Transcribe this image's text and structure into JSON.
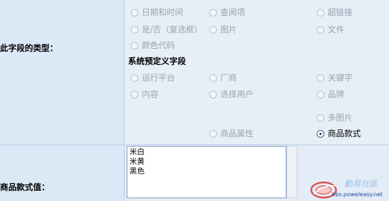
{
  "fields": {
    "type_label": "此字段的类型：",
    "value_label": "商品款式值："
  },
  "options_basic": [
    {
      "label": "日期和时间",
      "selected": false,
      "enabled": false
    },
    {
      "label": "查阅项",
      "selected": false,
      "enabled": false
    },
    {
      "label": "超链接",
      "selected": false,
      "enabled": false
    },
    {
      "label": "是/否（复选框）",
      "selected": false,
      "enabled": false
    },
    {
      "label": "图片",
      "selected": false,
      "enabled": false
    },
    {
      "label": "文件",
      "selected": false,
      "enabled": false
    },
    {
      "label": "颜色代码",
      "selected": false,
      "enabled": false
    }
  ],
  "system_section_title": "系统预定义字段",
  "options_system": [
    {
      "label": "运行平台",
      "selected": false,
      "enabled": false
    },
    {
      "label": "厂商",
      "selected": false,
      "enabled": false
    },
    {
      "label": "关键字",
      "selected": false,
      "enabled": false
    },
    {
      "label": "内容",
      "selected": false,
      "enabled": false
    },
    {
      "label": "选择用户",
      "selected": false,
      "enabled": false
    },
    {
      "label": "品牌",
      "selected": false,
      "enabled": false
    },
    {
      "label": "多图片",
      "selected": false,
      "enabled": false
    },
    {
      "label": "商品属性",
      "selected": false,
      "enabled": false
    },
    {
      "label": "商品款式",
      "selected": true,
      "enabled": true
    }
  ],
  "style_values": "米白\n米黄\n黑色",
  "watermark": {
    "url": "bbs.poweleasy.net"
  }
}
